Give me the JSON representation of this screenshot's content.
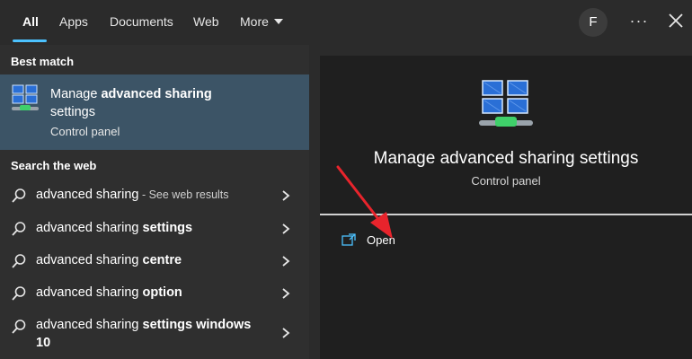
{
  "tabs": [
    {
      "label": "All",
      "active": true
    },
    {
      "label": "Apps"
    },
    {
      "label": "Documents"
    },
    {
      "label": "Web"
    },
    {
      "label": "More"
    }
  ],
  "user_avatar_initial": "F",
  "more_options_glyph": "···",
  "left": {
    "best_match_header": "Best match",
    "best_match": {
      "title_prefix": "Manage ",
      "title_bold": "advanced sharing",
      "title_suffix": "settings",
      "subtitle": "Control panel",
      "icon": "network-computers-icon"
    },
    "web_header": "Search the web",
    "web_items": [
      {
        "prefix": "advanced sharing",
        "bold": "",
        "suffix": " - See web results"
      },
      {
        "prefix": "advanced sharing ",
        "bold": "settings",
        "suffix": ""
      },
      {
        "prefix": "advanced sharing ",
        "bold": "centre",
        "suffix": ""
      },
      {
        "prefix": "advanced sharing ",
        "bold": "option",
        "suffix": ""
      },
      {
        "prefix": "advanced sharing ",
        "bold": "settings windows",
        "line2": "10"
      }
    ]
  },
  "right": {
    "title": "Manage advanced sharing settings",
    "subtitle": "Control panel",
    "actions": [
      {
        "label": "Open",
        "icon": "open-external-icon"
      }
    ]
  },
  "colors": {
    "accent": "#4cc2ff",
    "selection": "#3c5466",
    "annotation_arrow": "#e8242c"
  }
}
